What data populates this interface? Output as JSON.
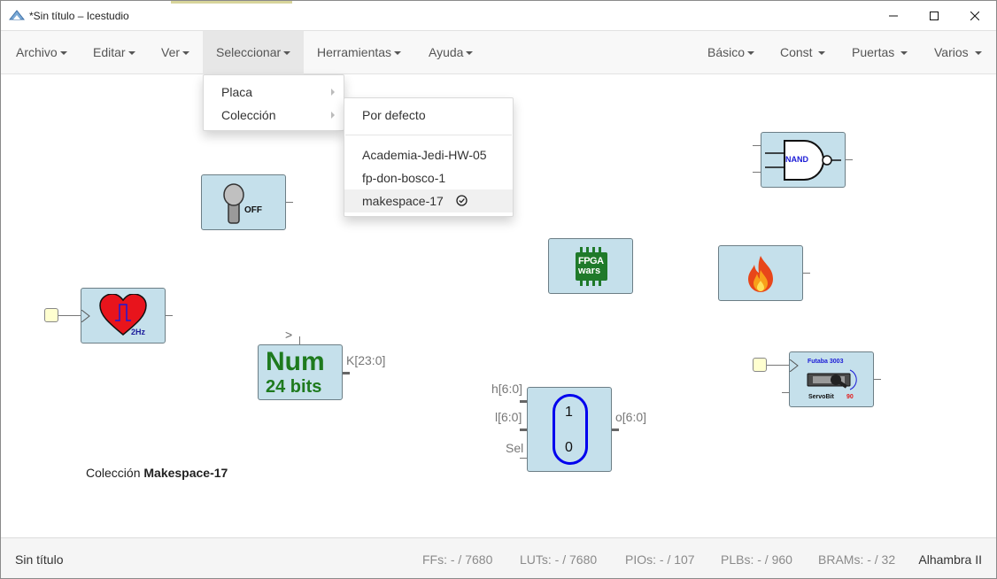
{
  "window": {
    "title": "*Sin título – Icestudio",
    "icon": "icestudio-logo-icon",
    "controls": [
      "minimize-icon",
      "maximize-icon",
      "close-icon"
    ]
  },
  "menubar": {
    "left": [
      {
        "label": "Archivo"
      },
      {
        "label": "Editar"
      },
      {
        "label": "Ver"
      },
      {
        "label": "Seleccionar"
      },
      {
        "label": "Herramientas"
      },
      {
        "label": "Ayuda"
      }
    ],
    "right": [
      {
        "label": "Básico"
      },
      {
        "label": "Const"
      },
      {
        "label": "Puertas"
      },
      {
        "label": "Varios"
      }
    ]
  },
  "select_menu": {
    "items": [
      {
        "label": "Placa"
      },
      {
        "label": "Colección"
      }
    ]
  },
  "collection_menu": {
    "default_label": "Por defecto",
    "items": [
      {
        "label": "Academia-Jedi-HW-05"
      },
      {
        "label": "fp-don-bosco-1"
      },
      {
        "label": "makespace-17",
        "selected": true
      }
    ]
  },
  "canvas": {
    "switch_block": {
      "icon": "toggle-switch-icon",
      "text": "OFF"
    },
    "heart_block": {
      "icon": "heart-clock-icon",
      "text": "2Hz"
    },
    "nand_block": {
      "icon": "nand-gate-icon",
      "text": "NAND"
    },
    "fpgawars_block": {
      "icon": "fpga-wars-logo-icon",
      "line1": "FPGA",
      "line2": "wars"
    },
    "fire_block": {
      "icon": "fire-icon"
    },
    "num_block": {
      "line1": "Num",
      "line2": "24 bits",
      "input_symbol": ">",
      "output_label": "K[23:0]"
    },
    "mux_block": {
      "input_h": "h[6:0]",
      "input_l": "l[6:0]",
      "input_sel": "Sel",
      "output": "o[6:0]",
      "top": "1",
      "bottom": "0"
    },
    "servo_block": {
      "icon": "servo-motor-icon",
      "brand": "Futaba 3003",
      "name": "ServoBit",
      "value": "90"
    },
    "collection_label": {
      "prefix": "Colección",
      "name": "Makespace-17"
    }
  },
  "statusbar": {
    "project": "Sin título",
    "ffs": "FFs:  - / 7680",
    "luts": "LUTs:  - / 7680",
    "pios": "PIOs:  - / 107",
    "plbs": "PLBs:  - / 960",
    "brams": "BRAMs:  - / 32",
    "board": "Alhambra II"
  },
  "colors": {
    "block_fill": "#c5e0eb",
    "num_green": "#1e7a1e",
    "mux_blue": "#0000ee",
    "menu_active": "#e7e7e7"
  }
}
